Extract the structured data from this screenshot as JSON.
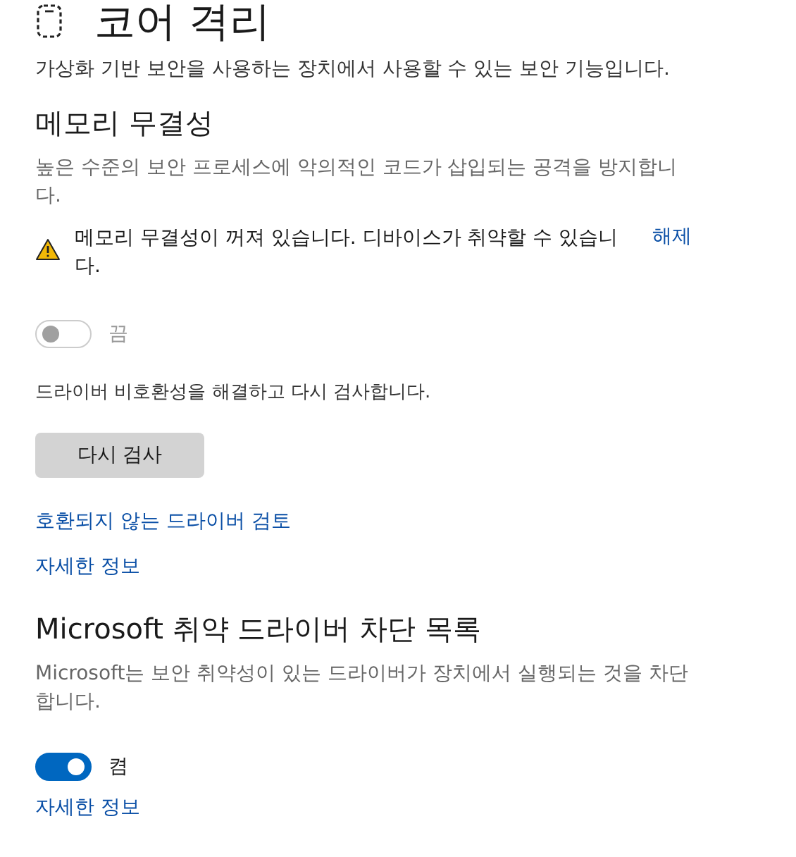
{
  "page": {
    "title": "코어 격리",
    "subtitle": "가상화 기반 보안을 사용하는 장치에서 사용할 수 있는 보안 기능입니다."
  },
  "sections": [
    {
      "heading": "메모리 무결성",
      "description": "높은 수준의 보안 프로세스에 악의적인 코드가 삽입되는 공격을 방지합니다.",
      "warning": {
        "text": "메모리 무결성이 꺼져 있습니다. 디바이스가 취약할 수 있습니다.",
        "action": "해제"
      },
      "toggle": {
        "on": false,
        "disabled": true,
        "label": "끔"
      },
      "note": "드라이버 비호환성을 해결하고 다시 검사합니다.",
      "button": "다시 검사",
      "links": [
        "호환되지 않는 드라이버 검토",
        "자세한 정보"
      ]
    },
    {
      "heading": "Microsoft 취약 드라이버 차단 목록",
      "description": "Microsoft는 보안 취약성이 있는 드라이버가 장치에서 실행되는 것을 차단합니다.",
      "toggle": {
        "on": true,
        "disabled": false,
        "label": "켬"
      },
      "links": [
        "자세한 정보"
      ]
    }
  ]
}
